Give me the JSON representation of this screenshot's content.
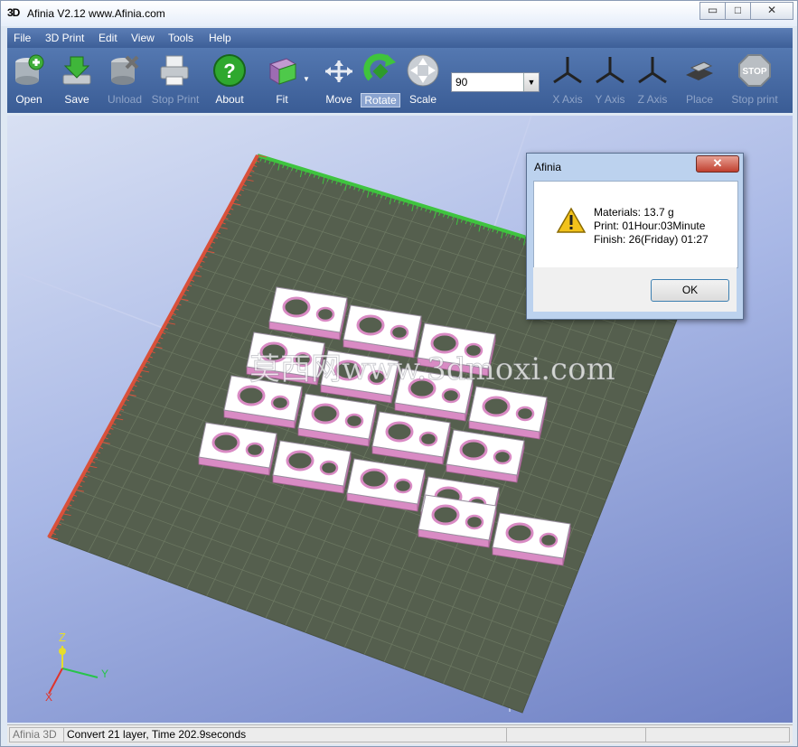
{
  "window": {
    "app_icon": "3D",
    "title": "Afinia  V2.12  www.Afinia.com",
    "minimize_glyph": "▭",
    "maximize_glyph": "□",
    "close_glyph": "✕"
  },
  "menu": [
    "File",
    "3D Print",
    "Edit",
    "View",
    "Tools",
    "Help"
  ],
  "toolbar": {
    "open": "Open",
    "save": "Save",
    "unload": "Unload",
    "stop_print": "Stop Print",
    "about": "About",
    "fit": "Fit",
    "move": "Move",
    "rotate": "Rotate",
    "scale": "Scale",
    "rotation_value": "90",
    "x_axis": "X Axis",
    "y_axis": "Y Axis",
    "z_axis": "Z Axis",
    "place": "Place",
    "stop_print_2": "Stop print",
    "stop_sign_text": "STOP"
  },
  "viewport": {
    "watermark": "莫西网www.3dmoxi.com",
    "axis_labels": {
      "z": "Z",
      "y": "Y",
      "x": "X"
    },
    "part_count": 17
  },
  "dialog": {
    "title": "Afinia",
    "close_glyph": "✕",
    "materials": "Materials: 13.7 g",
    "print": "Print: 01Hour:03Minute",
    "finish": "Finish: 26(Friday) 01:27",
    "ok": "OK"
  },
  "status": {
    "app": "Afinia 3D",
    "message": "Convert 21 layer, Time  202.9seconds"
  },
  "colors": {
    "toolbar": "#3a5c95",
    "platform": "#555f4e",
    "part_top": "#ffffff",
    "part_side": "#d98bc4",
    "ruler_x": "#3fc43f",
    "ruler_y": "#d9503a"
  }
}
